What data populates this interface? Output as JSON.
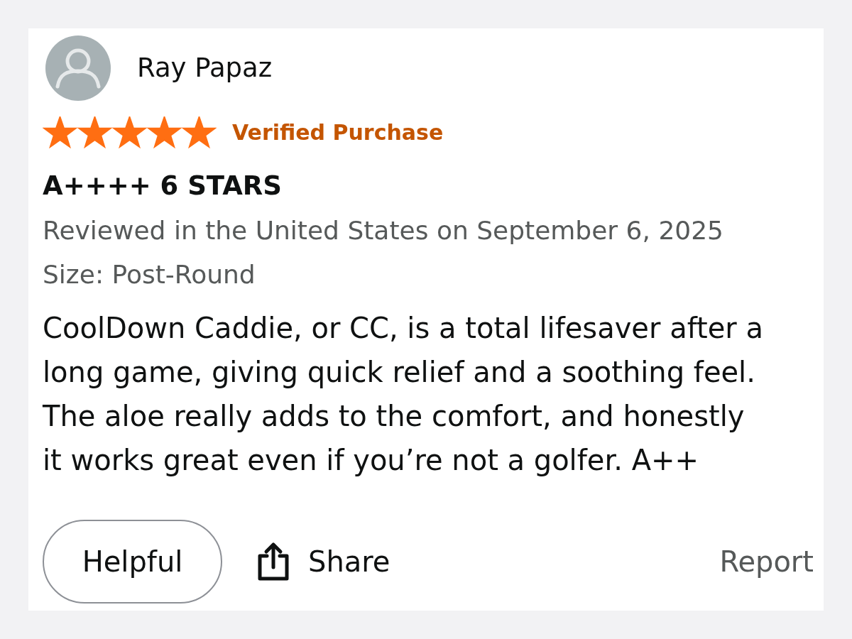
{
  "review": {
    "reviewer": {
      "name": "Ray Papaz"
    },
    "stars": 5,
    "badge": "Verified Purchase",
    "title": "A++++ 6 STARS",
    "meta": "Reviewed in the United States on September 6, 2025",
    "variant": "Size: Post-Round",
    "body": "CoolDown Caddie, or CC, is a total lifesaver after a long game, giving quick relief and a soothing feel. The aloe really adds to the comfort, and honestly it works great even if you’re not a golfer. A++",
    "actions": [
      {
        "kind": "pill",
        "label": "Helpful"
      },
      {
        "kind": "share",
        "label": "Share"
      },
      {
        "kind": "link",
        "label": "Report"
      }
    ]
  }
}
